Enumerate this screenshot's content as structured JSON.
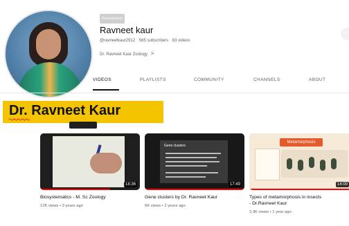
{
  "channel": {
    "badge_text": "Ravneet kaur",
    "name": "Ravneet kaur",
    "handle": "@ravneetkaur2912",
    "subscribers": "565 subscribers",
    "videos_count": "63 videos",
    "description": "Dr. Ravneet Kaur Zoology",
    "description_chevron": ">"
  },
  "tabs": [
    {
      "label": "VIDEOS"
    },
    {
      "label": "PLAYLISTS"
    },
    {
      "label": "COMMUNITY"
    },
    {
      "label": "CHANNELS"
    },
    {
      "label": "ABOUT"
    }
  ],
  "overlay_label": "Dr. Ravneet Kaur",
  "videos": [
    {
      "title": "Biosystematics - M. Sc Zoology",
      "stats": "12K views • 3 years ago",
      "duration": "18:36"
    },
    {
      "title": "Gene clusters by Dr. Ravneet Kaur",
      "stats": "6K views • 2 years ago",
      "duration": "17:49",
      "thumbnail_heading": "Gene clusters"
    },
    {
      "title_line1": "Types of metamorphosis in insects",
      "title_line2": "- Dr.Ravneet Kaur",
      "stats": "2.3K views • 1 year ago",
      "duration": "14:00",
      "thumbnail_banner": "Metamorphosis"
    }
  ],
  "icons": {
    "avatar": "avatar-photo",
    "chevron": "chevron-right-icon"
  },
  "colors": {
    "overlay_yellow": "#f5c400",
    "progress_red": "#ff0000"
  }
}
